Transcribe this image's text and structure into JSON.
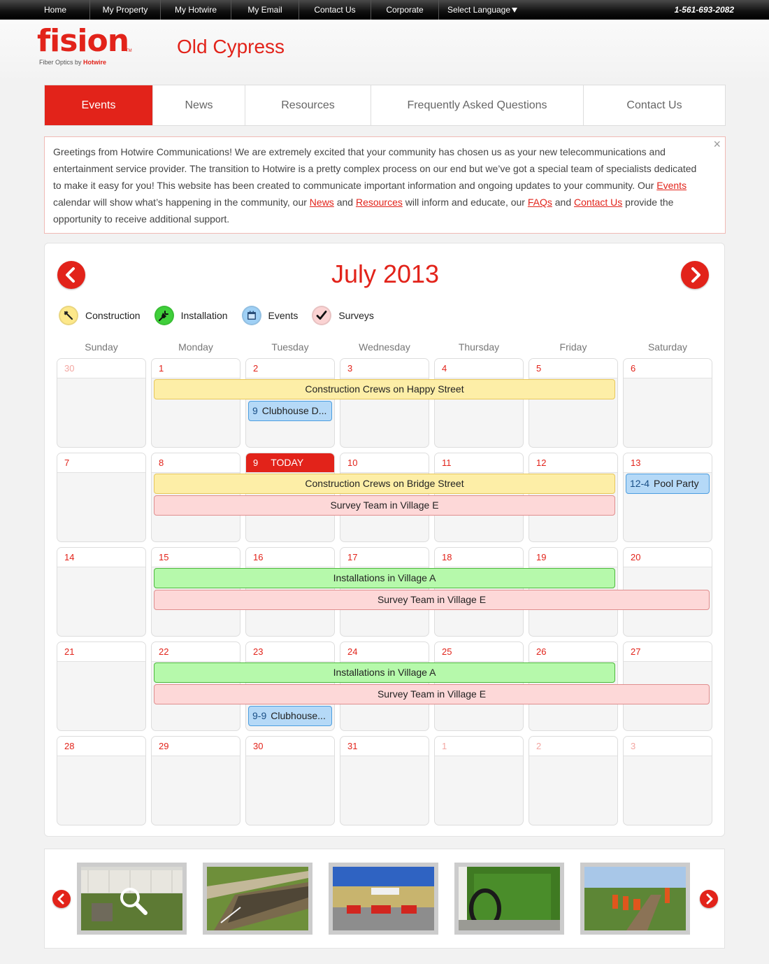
{
  "topnav": {
    "items": [
      {
        "label": "Home",
        "id": "home"
      },
      {
        "label": "My Property",
        "id": "my-property"
      },
      {
        "label": "My Hotwire",
        "id": "my-hotwire"
      },
      {
        "label": "My Email",
        "id": "my-email"
      },
      {
        "label": "Contact Us",
        "id": "contact-us"
      },
      {
        "label": "Corporate",
        "id": "corporate"
      }
    ],
    "language_label": "Select Language",
    "phone": "1-561-693-2082"
  },
  "brand": {
    "logo_word": "fision",
    "logo_tm": "TM",
    "logo_sub_prefix": "Fiber Optics by ",
    "logo_sub_brand": "Hotwire",
    "site_title": "Old Cypress",
    "accent_color": "#e2231a"
  },
  "tabs": [
    {
      "label": "Events",
      "active": true
    },
    {
      "label": "News",
      "active": false
    },
    {
      "label": "Resources",
      "active": false
    },
    {
      "label": "Frequently Asked Questions",
      "active": false
    },
    {
      "label": "Contact Us",
      "active": false
    }
  ],
  "notice": {
    "text_1": "Greetings from Hotwire Communications!  We are extremely excited that your community has chosen us as your new telecommunications and entertainment service provider.  The transition to Hotwire is a pretty complex process on our end but we’ve got a special team of specialists dedicated to make it easy for you!  This website has been created to communicate important information and ongoing updates to your community.  Our ",
    "link_events": "Events",
    "text_2": " calendar will show what’s happening in the community, our ",
    "link_news": "News",
    "text_3": " and ",
    "link_resources": "Resources",
    "text_4": " will inform and educate, our ",
    "link_faqs": "FAQs",
    "text_5": " and ",
    "link_contact": "Contact Us",
    "text_6": " provide the opportunity to receive additional support.",
    "close_glyph": "×"
  },
  "calendar": {
    "month_label": "July 2013",
    "legend": [
      {
        "label": "Construction",
        "icon": "hammer-icon",
        "color": "#fde88a"
      },
      {
        "label": "Installation",
        "icon": "plug-icon",
        "color": "#3fcf3a"
      },
      {
        "label": "Events",
        "icon": "calendar-icon",
        "color": "#9fd0f5"
      },
      {
        "label": "Surveys",
        "icon": "checkmark-icon",
        "color": "#fbd3d3"
      }
    ],
    "weekdays": [
      "Sunday",
      "Monday",
      "Tuesday",
      "Wednesday",
      "Thursday",
      "Friday",
      "Saturday"
    ],
    "today_label": "TODAY",
    "weeks": [
      [
        {
          "d": "30",
          "other": true
        },
        {
          "d": "1"
        },
        {
          "d": "2"
        },
        {
          "d": "3"
        },
        {
          "d": "4"
        },
        {
          "d": "5"
        },
        {
          "d": "6"
        }
      ],
      [
        {
          "d": "7"
        },
        {
          "d": "8"
        },
        {
          "d": "9",
          "today": true
        },
        {
          "d": "10"
        },
        {
          "d": "11"
        },
        {
          "d": "12"
        },
        {
          "d": "13"
        }
      ],
      [
        {
          "d": "14"
        },
        {
          "d": "15"
        },
        {
          "d": "16"
        },
        {
          "d": "17"
        },
        {
          "d": "18"
        },
        {
          "d": "19"
        },
        {
          "d": "20"
        }
      ],
      [
        {
          "d": "21"
        },
        {
          "d": "22"
        },
        {
          "d": "23"
        },
        {
          "d": "24"
        },
        {
          "d": "25"
        },
        {
          "d": "26"
        },
        {
          "d": "27"
        }
      ],
      [
        {
          "d": "28"
        },
        {
          "d": "29"
        },
        {
          "d": "30"
        },
        {
          "d": "31"
        },
        {
          "d": "1",
          "other": true
        },
        {
          "d": "2",
          "other": true
        },
        {
          "d": "3",
          "other": true
        }
      ]
    ],
    "events": [
      {
        "week": 0,
        "start": 1,
        "end": 5,
        "slot": 0,
        "type": "cons",
        "label": "Construction Crews on Happy Street"
      },
      {
        "week": 0,
        "start": 2,
        "end": 2,
        "slot": 1,
        "type": "evt",
        "time": "9",
        "label": "Clubhouse D..."
      },
      {
        "week": 1,
        "start": 1,
        "end": 5,
        "slot": 0,
        "type": "cons",
        "label": "Construction Crews on Bridge Street"
      },
      {
        "week": 1,
        "start": 6,
        "end": 6,
        "slot": 0,
        "type": "evt",
        "time": "12-4",
        "label": "Pool Party"
      },
      {
        "week": 1,
        "start": 1,
        "end": 5,
        "slot": 1,
        "type": "surv",
        "label": "Survey Team in Village E"
      },
      {
        "week": 2,
        "start": 1,
        "end": 5,
        "slot": 0,
        "type": "inst",
        "label": "Installations in Village A"
      },
      {
        "week": 2,
        "start": 1,
        "end": 6,
        "slot": 1,
        "type": "surv",
        "label": "Survey Team in Village E"
      },
      {
        "week": 3,
        "start": 1,
        "end": 5,
        "slot": 0,
        "type": "inst",
        "label": "Installations in Village A"
      },
      {
        "week": 3,
        "start": 1,
        "end": 6,
        "slot": 1,
        "type": "surv",
        "label": "Survey Team in Village E"
      },
      {
        "week": 3,
        "start": 2,
        "end": 2,
        "slot": 2,
        "type": "evt",
        "time": "9-9",
        "label": "Clubhouse..."
      }
    ]
  },
  "gallery": {
    "photos": [
      "photo-utility-box",
      "photo-trench",
      "photo-tent-event",
      "photo-cable-spool",
      "photo-crew-trench"
    ]
  }
}
